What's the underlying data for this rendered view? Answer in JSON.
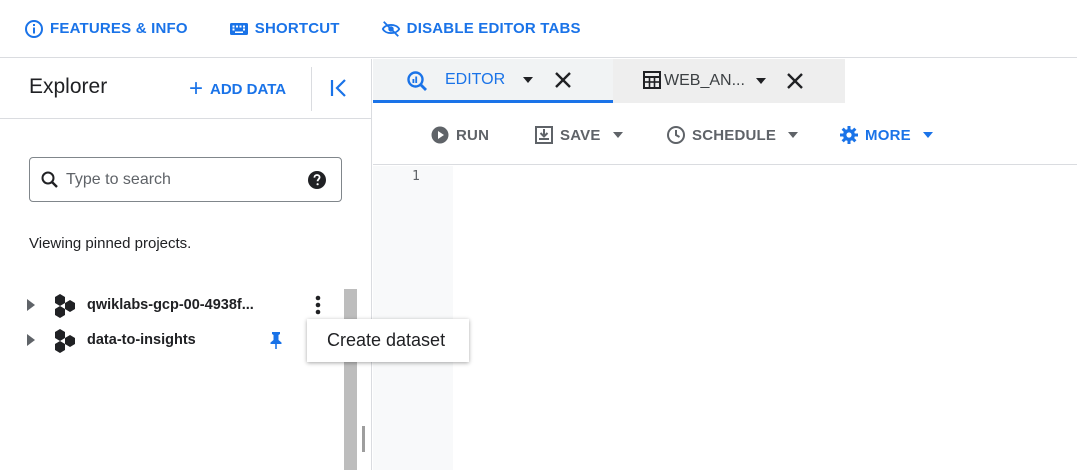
{
  "topbar": {
    "features": "FEATURES & INFO",
    "shortcut": "SHORTCUT",
    "disable_tabs": "DISABLE EDITOR TABS"
  },
  "explorer": {
    "title": "Explorer",
    "add_data": "ADD DATA",
    "search_placeholder": "Type to search",
    "viewing_text": "Viewing pinned projects.",
    "projects": [
      {
        "name": "qwiklabs-gcp-00-4938f..."
      },
      {
        "name": "data-to-insights"
      }
    ],
    "context_menu": {
      "item": "Create dataset"
    }
  },
  "tabs": [
    {
      "label": "EDITOR",
      "icon": "query-icon"
    },
    {
      "label": "WEB_AN...",
      "icon": "table-icon"
    }
  ],
  "toolbar": {
    "run": "RUN",
    "save": "SAVE",
    "schedule": "SCHEDULE",
    "more": "MORE"
  },
  "editor": {
    "line_numbers": [
      "1"
    ]
  },
  "colors": {
    "accent": "#1a73e8",
    "muted": "#5f6368"
  }
}
